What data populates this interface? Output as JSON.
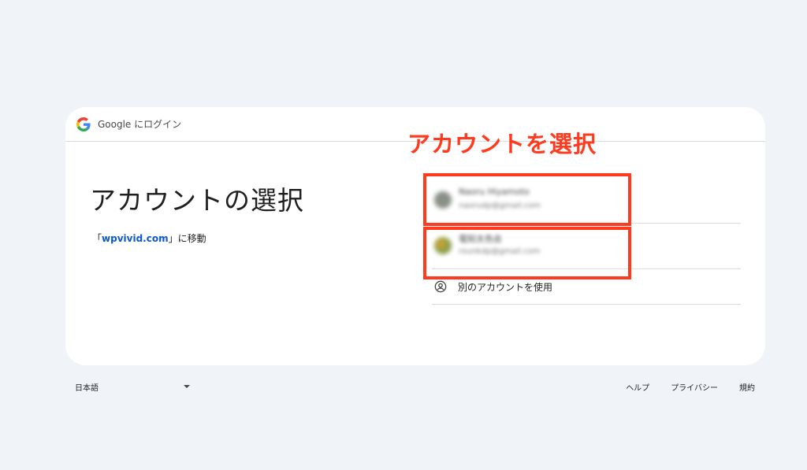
{
  "header": {
    "text": "Google にログイン"
  },
  "main": {
    "title": "アカウントの選択",
    "subtitle_prefix": "「",
    "subtitle_link": "wpvivid.com",
    "subtitle_suffix": "」に移動"
  },
  "annotation": {
    "text": "アカウントを選択",
    "color": "#ff3b1f"
  },
  "accounts": [
    {
      "name": "Naoru Hiyamoto",
      "email": "naorudp@gmail.com",
      "blurred": true
    },
    {
      "name": "電知太色会",
      "email": "rounkdp@gmail.com",
      "blurred": true
    }
  ],
  "other_account": {
    "label": "別のアカウントを使用",
    "icon": "account-circle-icon"
  },
  "footer": {
    "language": "日本語",
    "links": [
      "ヘルプ",
      "プライバシー",
      "規約"
    ]
  },
  "colors": {
    "background": "#f0f4f9",
    "card": "#ffffff",
    "link": "#0b57d0",
    "highlight": "#ff3b1f"
  }
}
